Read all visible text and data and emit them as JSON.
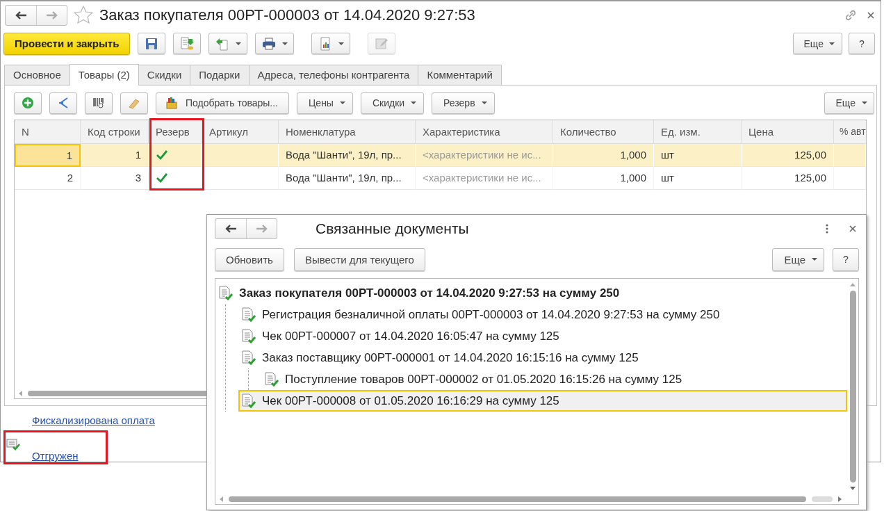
{
  "window": {
    "title": "Заказ покупателя 00РТ-000003 от 14.04.2020 9:27:53"
  },
  "toolbar": {
    "primary": "Провести и закрыть",
    "more": "Еще",
    "help": "?"
  },
  "tabs": [
    {
      "label": "Основное",
      "selected": false
    },
    {
      "label": "Товары (2)",
      "selected": true
    },
    {
      "label": "Скидки",
      "selected": false
    },
    {
      "label": "Подарки",
      "selected": false
    },
    {
      "label": "Адреса, телефоны контрагента",
      "selected": false
    },
    {
      "label": "Комментарий",
      "selected": false
    }
  ],
  "table_toolbar": {
    "pick": "Подобрать товары...",
    "menus": [
      "Цены",
      "Скидки",
      "Резерв"
    ],
    "more": "Еще"
  },
  "table": {
    "columns": [
      "N",
      "Код строки",
      "Резерв",
      "Артикул",
      "Номенклатура",
      "Характеристика",
      "Количество",
      "Ед. изм.",
      "Цена",
      "% авт"
    ],
    "rows": [
      {
        "selected": true,
        "n": "1",
        "line_code": "1",
        "reserved": true,
        "nomenclature": "Вода \"Шанти\", 19л, пр...",
        "characteristic": "<характеристики не ис...",
        "quantity": "1,000",
        "unit": "шт",
        "price": "125,00"
      },
      {
        "selected": false,
        "n": "2",
        "line_code": "3",
        "reserved": true,
        "nomenclature": "Вода \"Шанти\", 19л, пр...",
        "characteristic": "<характеристики не ис...",
        "quantity": "1,000",
        "unit": "шт",
        "price": "125,00"
      }
    ]
  },
  "footer_links": [
    {
      "kind": "plain",
      "label": "Фискализирована оплата"
    },
    {
      "kind": "with_icon",
      "label": "Отгружен"
    }
  ],
  "related_documents": {
    "title": "Связанные документы",
    "buttons": [
      "Обновить",
      "Вывести для текущего"
    ],
    "more": "Еще",
    "help": "?",
    "tree": [
      {
        "label": "Заказ покупателя 00РТ-000003 от 14.04.2020 9:27:53 на сумму 250",
        "selected": false,
        "children": [
          {
            "label": "Регистрация безналичной оплаты 00РТ-000003 от 14.04.2020 9:27:53 на сумму 250",
            "selected": false
          },
          {
            "label": "Чек 00РТ-000007 от 14.04.2020 16:05:47 на сумму 125",
            "selected": false
          },
          {
            "label": "Заказ поставщику 00РТ-000001 от 14.04.2020 16:15:16 на сумму 125",
            "selected": false,
            "children": [
              {
                "label": "Поступление товаров 00РТ-000002 от 01.05.2020 16:15:26 на сумму 125",
                "selected": false
              }
            ]
          },
          {
            "label": "Чек 00РТ-000008 от 01.05.2020 16:16:29 на сумму 125",
            "selected": true
          }
        ]
      }
    ]
  }
}
